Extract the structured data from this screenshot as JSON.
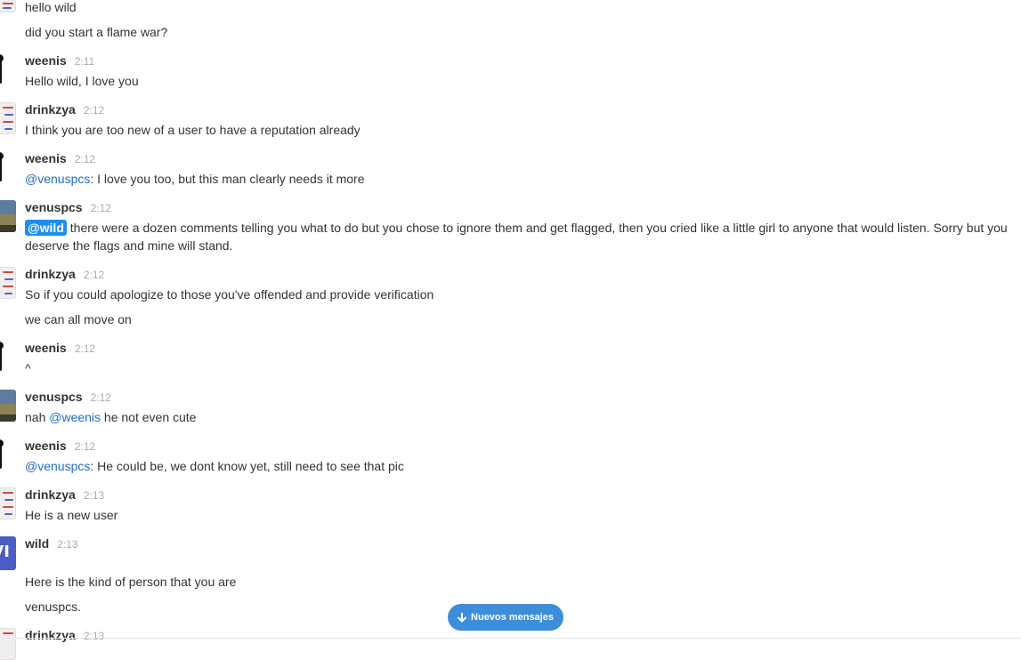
{
  "messages": [
    {
      "text": "hello wild"
    },
    {
      "text": "did you start a flame war?"
    },
    {
      "user": "weenis",
      "time": "2:11",
      "text": "Hello wild, I love you"
    },
    {
      "user": "drinkzya",
      "time": "2:12",
      "text": "I think you are too new of a user to have a reputation already"
    },
    {
      "user": "weenis",
      "time": "2:12",
      "mention": "@venuspcs",
      "text": ": I love you too, but this man clearly needs it more"
    },
    {
      "user": "venuspcs",
      "time": "2:12",
      "mention": "@wild",
      "text": " there were a dozen comments telling you what to do but you chose to ignore them and get flagged, then you cried like a little girl to anyone that would listen. Sorry but you deserve the flags and mine will stand."
    },
    {
      "user": "drinkzya",
      "time": "2:12",
      "text": "So if you could apologize to those you've offended and provide verification"
    },
    {
      "text": "we can all move on"
    },
    {
      "user": "weenis",
      "time": "2:12",
      "text": "^"
    },
    {
      "user": "venuspcs",
      "time": "2:12",
      "prefix": "nah ",
      "mention": "@weenis",
      "text": " he not even cute"
    },
    {
      "user": "weenis",
      "time": "2:12",
      "mention": "@venuspcs",
      "text": ": He could be, we dont know yet, still need to see that pic"
    },
    {
      "user": "drinkzya",
      "time": "2:13",
      "text": "He is a new user"
    },
    {
      "user": "wild",
      "time": "2:13",
      "avatar_text": "VI"
    },
    {
      "text": "Here is the kind of person that you are"
    },
    {
      "text": "venuspcs."
    },
    {
      "user": "drinkzya",
      "time": "2:13"
    }
  ],
  "new_messages_button": {
    "label": "Nuevos mensajes",
    "icon": "arrow-down-icon"
  },
  "colors": {
    "mention": "#1d6ec3",
    "mention_me_bg": "#1d8ef0",
    "button_bg": "#3d8ed9",
    "wild_avatar": "#4b5ec5"
  }
}
